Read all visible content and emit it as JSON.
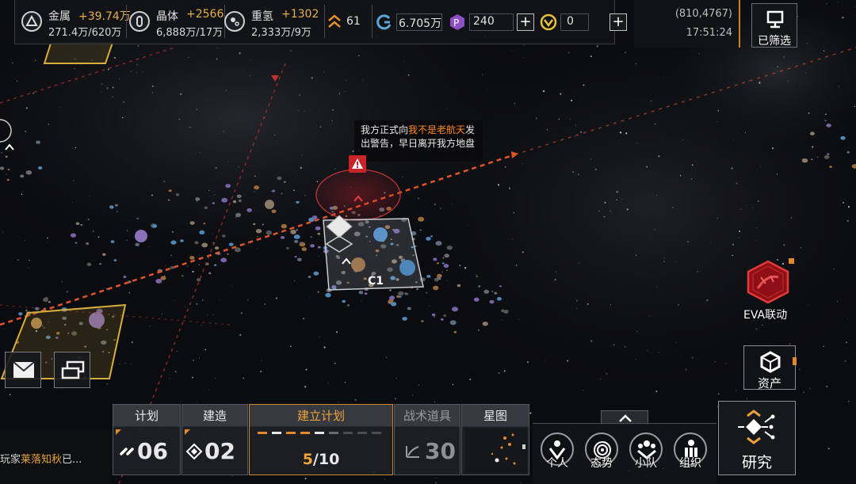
{
  "resources": [
    {
      "name": "金属",
      "delta": "+39.74万",
      "amount": "271.4万/620万",
      "icon": "metal-icon"
    },
    {
      "name": "晶体",
      "delta": "+2566",
      "amount": "6,888万/17万",
      "icon": "crystal-icon"
    },
    {
      "name": "重氢",
      "delta": "+1302",
      "amount": "2,333万/9万",
      "icon": "deuterium-icon"
    }
  ],
  "rank": {
    "value": "61",
    "icon": "rank-chevron-icon"
  },
  "credits": {
    "value": "6.705万",
    "icon": "credit-icon"
  },
  "premium_a": {
    "value": "240",
    "icon": "hexagon-currency-icon"
  },
  "premium_b": {
    "value": "0",
    "icon": "gold-coin-icon"
  },
  "coords": "(810,4767)",
  "time": "17:51:24",
  "filter_label": "已筛选",
  "warning": {
    "line1_pre": "我方正式向",
    "target": "我不是老航天",
    "line1_post": "发",
    "line2": "出警告，早日离开我方地盘"
  },
  "map": {
    "zone_label": "C1"
  },
  "chat_ticker": {
    "pre": "玩家",
    "name": "莱落知秋",
    "post": "已..."
  },
  "eva_label": "EVA联动",
  "assets_label": "资产",
  "panels": {
    "plan": {
      "title": "计划",
      "value": "06"
    },
    "build": {
      "title": "建造",
      "value": "02"
    },
    "establish": {
      "title": "建立计划",
      "progress": "5/10",
      "current": "5",
      "total": "/10"
    },
    "tactics": {
      "title": "战术道具",
      "value": "30"
    },
    "starmap": {
      "title": "星图"
    }
  },
  "bottom_nav": [
    {
      "label": "个人",
      "icon": "person-icon"
    },
    {
      "label": "态势",
      "icon": "radar-icon"
    },
    {
      "label": "小队",
      "icon": "squad-icon"
    },
    {
      "label": "组织",
      "icon": "organization-icon"
    }
  ],
  "research_label": "研究",
  "colors": {
    "accent": "#e28a28",
    "warning_red": "#c8242a",
    "highlight": "#ff8a24"
  }
}
